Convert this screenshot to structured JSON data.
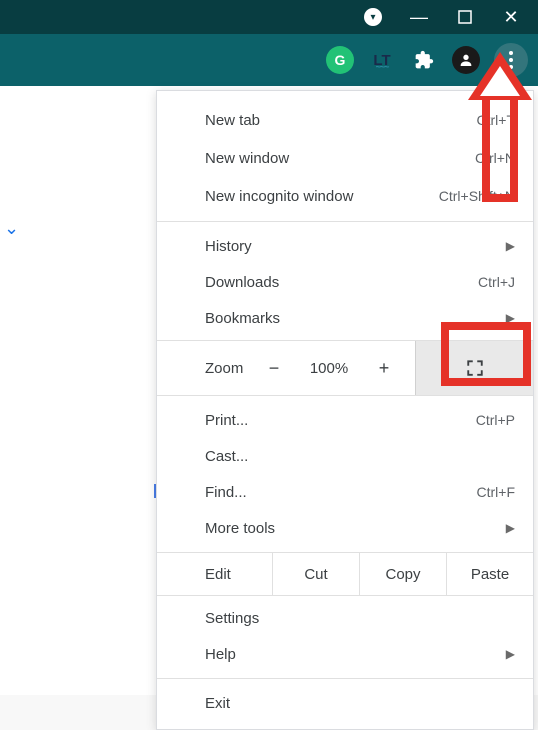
{
  "titlebar": {
    "minimize": "—",
    "maximize": "▭",
    "close": "✕"
  },
  "toolbar": {
    "grammarly": "G",
    "lt": "LT",
    "profile_glyph": "👤"
  },
  "menu": {
    "new_tab": {
      "label": "New tab",
      "shortcut": "Ctrl+T"
    },
    "new_window": {
      "label": "New window",
      "shortcut": "Ctrl+N"
    },
    "new_incognito": {
      "label": "New incognito window",
      "shortcut": "Ctrl+Shift+N"
    },
    "history": {
      "label": "History"
    },
    "downloads": {
      "label": "Downloads",
      "shortcut": "Ctrl+J"
    },
    "bookmarks": {
      "label": "Bookmarks"
    },
    "zoom": {
      "label": "Zoom",
      "minus": "−",
      "value": "100%",
      "plus": "+"
    },
    "print": {
      "label": "Print...",
      "shortcut": "Ctrl+P"
    },
    "cast": {
      "label": "Cast..."
    },
    "find": {
      "label": "Find...",
      "shortcut": "Ctrl+F"
    },
    "more_tools": {
      "label": "More tools"
    },
    "edit": {
      "label": "Edit",
      "cut": "Cut",
      "copy": "Copy",
      "paste": "Paste"
    },
    "settings": {
      "label": "Settings"
    },
    "help": {
      "label": "Help"
    },
    "exit": {
      "label": "Exit"
    }
  }
}
